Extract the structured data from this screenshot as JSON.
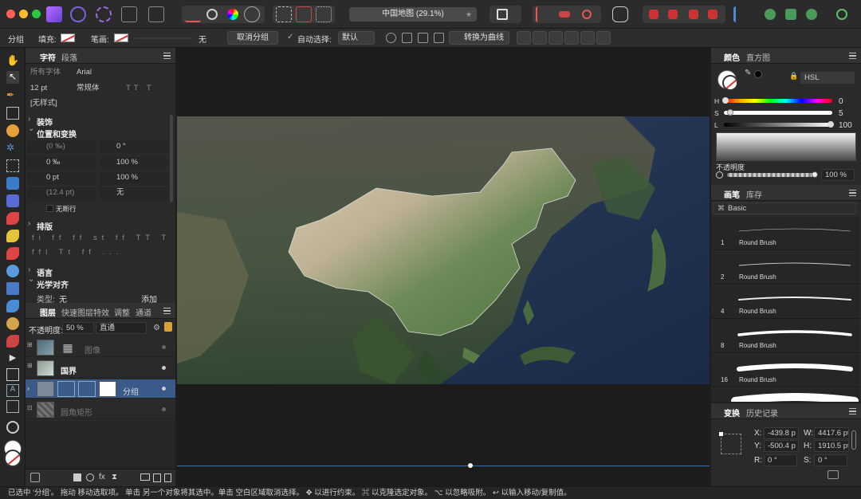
{
  "window": {
    "doc_title": "中国地图 (29.1%)"
  },
  "context_bar": {
    "group_label": "分组",
    "fill_label": "填充:",
    "stroke_label": "笔画:",
    "stroke_value": "无",
    "ungroup_button": "取消分组",
    "auto_select_label": "自动选择:",
    "auto_select_value": "默认",
    "convert_to_curves": "转换为曲线"
  },
  "character_panel": {
    "tabs": [
      "字符",
      "段落"
    ],
    "font_collection": "所有字体",
    "font_family": "Arial",
    "font_size": "12 pt",
    "font_style": "常规体",
    "style_preset": "[无样式]",
    "sections": {
      "decoration": "装饰",
      "position_transform": "位置和变换",
      "typography": "排版",
      "language": "语言",
      "optical_alignment": "光学对齐"
    },
    "transform_fields": [
      "(0 ‰)",
      "0 °",
      "0 ‰",
      "100 %",
      "0 pt",
      "100 %",
      "(12.4 pt)",
      "无"
    ],
    "no_break_label": "无断行",
    "optical_type_label": "类型:",
    "optical_type_value": "无",
    "optical_add_button": "添加"
  },
  "layers_panel": {
    "tabs": [
      "图层",
      "快速图层特效",
      "调整",
      "通道"
    ],
    "opacity_label": "不透明度:",
    "opacity_value": "50 %",
    "blend_mode": "直通",
    "layers": [
      {
        "name": "图像",
        "dimmed": true
      },
      {
        "name": "国界",
        "dimmed": false
      },
      {
        "name": "分组",
        "dimmed": false,
        "selected": true
      },
      {
        "name": "圆角矩形",
        "dimmed": true
      }
    ]
  },
  "color_panel": {
    "tabs": [
      "颜色",
      "直方图"
    ],
    "model": "HSL",
    "h_label": "H",
    "h_value": "0",
    "s_label": "S",
    "s_value": "5",
    "l_label": "L",
    "l_value": "100",
    "opacity_label": "不透明度",
    "opacity_value": "100 %"
  },
  "brushes_panel": {
    "tabs": [
      "画笔",
      "库存"
    ],
    "category": "Basic",
    "brushes": [
      {
        "size": "1",
        "name": "Round Brush"
      },
      {
        "size": "2",
        "name": "Round Brush"
      },
      {
        "size": "4",
        "name": "Round Brush"
      },
      {
        "size": "8",
        "name": "Round Brush"
      },
      {
        "size": "16",
        "name": "Round Brush"
      }
    ]
  },
  "transform_panel": {
    "tabs": [
      "变换",
      "历史记录"
    ],
    "x_label": "X:",
    "x_value": "-439.8 p",
    "y_label": "Y:",
    "y_value": "-500.4 p",
    "w_label": "W:",
    "w_value": "4417.6 pt",
    "h_label": "H:",
    "h_value": "1910.5 pt",
    "r_label": "R:",
    "r_value": "0 °",
    "s_label": "S:",
    "s_value": "0 °"
  },
  "status_bar": {
    "text": "已选中 '分组'。 拖动 移动选取项。 单击 另一个对象将其选中。单击 空白区域取消选择。 ✥ 以进行约束。 ⌘ 以克隆选定对象。 ⌥ 以忽略吸附。 ↩ 以输入移动/复制值。"
  },
  "colors": {
    "accent": "#3d6ea8",
    "selection": "#3a5a8a",
    "panel_bg": "#2a2a2a",
    "canvas_bg": "#1c1c1c"
  }
}
